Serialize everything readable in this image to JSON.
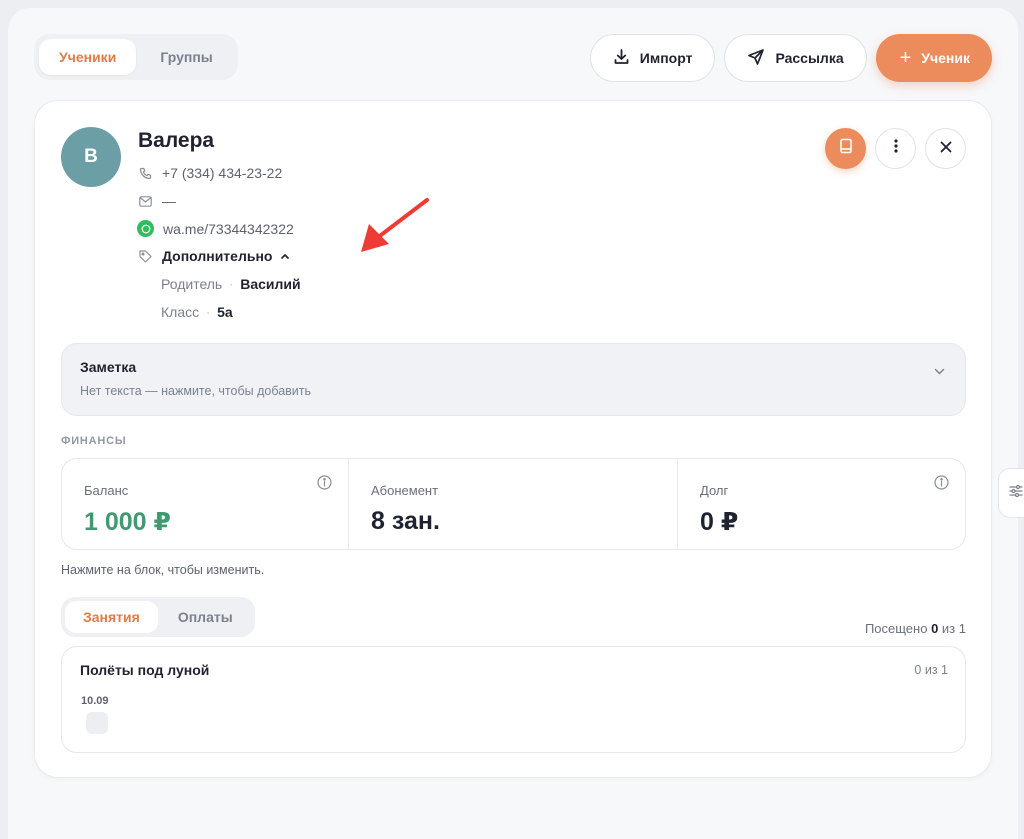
{
  "topbar": {
    "tabs": [
      {
        "label": "Ученики",
        "active": true
      },
      {
        "label": "Группы",
        "active": false
      }
    ],
    "import_label": "Импорт",
    "mailing_label": "Рассылка",
    "add_student_label": "Ученик",
    "add_icon": "+"
  },
  "student": {
    "avatar_letter": "В",
    "name": "Валера",
    "phone": "+7 (334) 434-23-22",
    "email": "—",
    "whatsapp": "wa.me/73344342322",
    "more_label": "Дополнительно",
    "extra": [
      {
        "key": "Родитель",
        "value": "Василий"
      },
      {
        "key": "Класс",
        "value": "5а"
      }
    ]
  },
  "note": {
    "title": "Заметка",
    "placeholder": "Нет текста — нажмите, чтобы добавить"
  },
  "finance": {
    "section_label": "ФИНАНСЫ",
    "balance": {
      "label": "Баланс",
      "value": "1 000 ₽"
    },
    "subscription": {
      "label": "Абонемент",
      "value": "8 зан."
    },
    "debt": {
      "label": "Долг",
      "value": "0 ₽"
    },
    "hint": "Нажмите на блок, чтобы изменить."
  },
  "activity": {
    "tabs": [
      {
        "label": "Занятия",
        "active": true
      },
      {
        "label": "Оплаты",
        "active": false
      }
    ],
    "visited_prefix": "Посещено",
    "visited_count": "0",
    "visited_suffix": "из 1",
    "lesson": {
      "title": "Полёты под луной",
      "count": "0 из 1",
      "date": "10.09"
    }
  },
  "colors": {
    "accent": "#ec8b5b",
    "balance_green": "#3f9a72",
    "avatar_bg": "#6c9ea6",
    "annotation_arrow": "#ee3b35"
  }
}
